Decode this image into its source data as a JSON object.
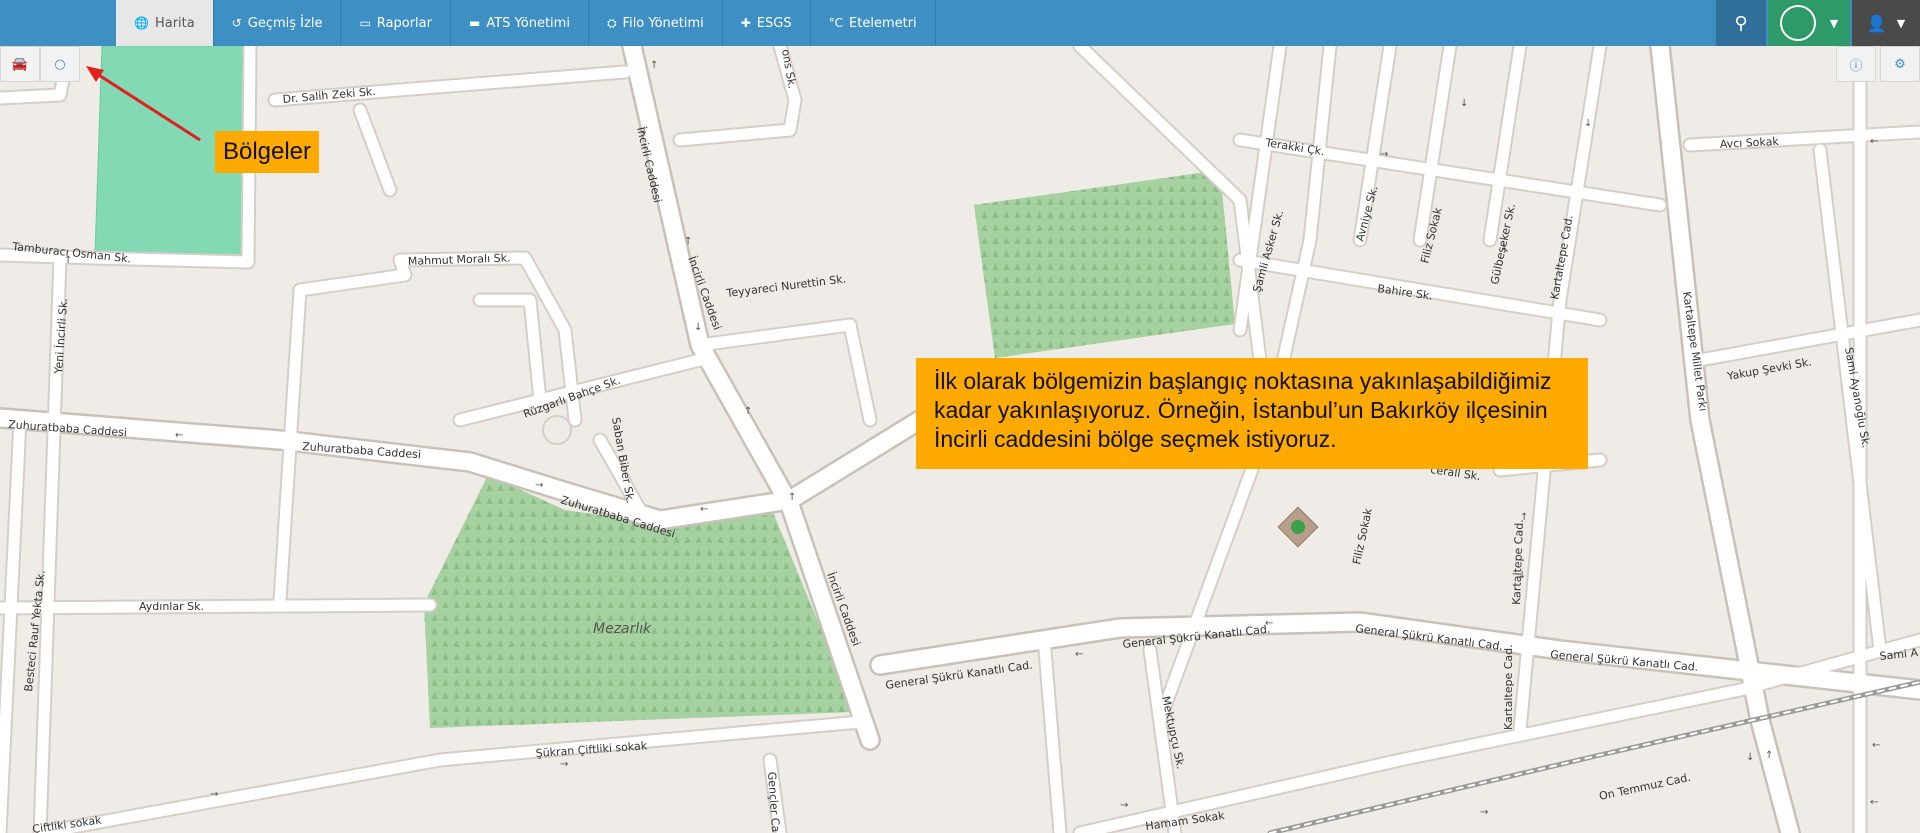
{
  "nav": {
    "items": [
      {
        "label": "Harita",
        "icon": "globe-icon",
        "active": true
      },
      {
        "label": "Geçmiş İzle",
        "icon": "history-icon",
        "active": false
      },
      {
        "label": "Raporlar",
        "icon": "file-icon",
        "active": false
      },
      {
        "label": "ATS Yönetimi",
        "icon": "monitor-icon",
        "active": false
      },
      {
        "label": "Filo Yönetimi",
        "icon": "cubes-icon",
        "active": false
      },
      {
        "label": "ESGS",
        "icon": "puzzle-icon",
        "active": false
      },
      {
        "label": "Etelemetri",
        "icon": "celsius-icon",
        "active": false
      }
    ],
    "search_icon": "search-icon",
    "user_icon": "user-icon"
  },
  "colors": {
    "topbar": "#3d8fc4",
    "status": "#2e9a6a",
    "callout": "#ffaa00",
    "arrow": "#e0201c",
    "region": "#82d9b4",
    "cemetery": "#a6d1a0"
  },
  "tools": {
    "left": [
      "car-icon",
      "circle-icon"
    ],
    "right": [
      "info-icon",
      "cogs-icon"
    ]
  },
  "callouts": {
    "regions_label": "Bölgeler",
    "instruction_line1": "İlk olarak bölgemizin başlangıç noktasına yakınlaşabildiğimiz",
    "instruction_line2": "kadar yakınlaşıyoruz. Örneğin, İstanbul’un Bakırköy ilçesinin",
    "instruction_line3": "İncirli caddesini bölge seçmek istiyoruz."
  },
  "map": {
    "labels": {
      "salih": "Dr. Salih Zeki Sk.",
      "tamburaci": "Tamburacı Osman Sk.",
      "yeni_incirli": "Yeni İncirli Sk.",
      "mahmut": "Mahmut Moralı Sk.",
      "teyyareci": "Teyyareci Nurettin Sk.",
      "incirli1": "İncirli Caddesi",
      "incirli2": "İncirli Caddesi",
      "incirli3": "İncirli Caddesi",
      "ruzgarli": "Rüzgarlı Bahçe Sk.",
      "saban": "Saban Biber Sk.",
      "zuhurat1": "Zuhuratbaba Caddesi",
      "zuhurat2": "Zuhuratbaba Caddesi",
      "zuhurat3": "Zuhuratbaba Caddesi",
      "aydinlar": "Aydınlar Sk.",
      "besteci": "Besteci Rauf Yekta Sk.",
      "mezarlik": "Mezarlık",
      "sukran": "Şükran Çiftliki sokak",
      "ciftliki": "Çiftliki sokak",
      "gencler": "Gençler Cad.",
      "general1": "General Şükrü Kanatlı Cad.",
      "general2": "General Şükrü Kanatlı Cad.",
      "general3": "General Şükrü Kanatlı Cad.",
      "general4": "General Şükrü Kanatlı Cad.",
      "mektupcu": "Mektupçu Sk.",
      "hamam": "Hamam Sokak",
      "terakki": "Terakki Çk.",
      "avci": "Avcı Sokak",
      "samli": "Şamli Asker Sk.",
      "avniye": "Avniye Sk.",
      "filiz1": "Filiz Sokak",
      "filiz2": "Filiz Sokak",
      "gulbeseker": "Gülbeşeker Sk.",
      "kartaltepe1": "Kartaltepe Cad.",
      "kartaltepe2": "Kartaltepe Cad.",
      "kartaltepe3": "Kartaltepe Cad.",
      "bahire": "Bahire Sk.",
      "kartaltepe_park": "Kartaltepe Millet Parkı",
      "yakup": "Yakup Şevki Sk.",
      "sami1": "Sami Ayanoğlu Sk.",
      "sami2": "Sami A",
      "on_temmuz": "On Temmuz Cad.",
      "cerall": "cerall Sk.",
      "top_sk": "ons Sk."
    }
  }
}
